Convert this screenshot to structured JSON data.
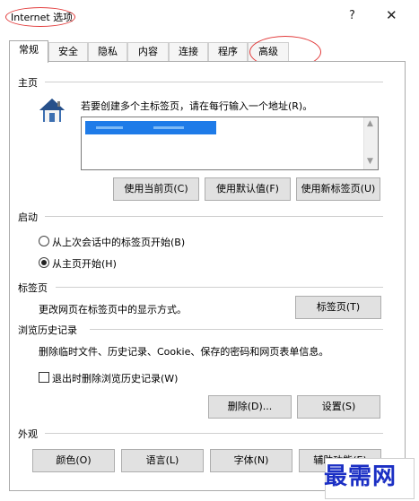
{
  "window": {
    "title": "Internet 选项",
    "help_label": "?",
    "close_label": "✕"
  },
  "tabs": [
    {
      "label": "常规",
      "active": true
    },
    {
      "label": "安全"
    },
    {
      "label": "隐私"
    },
    {
      "label": "内容"
    },
    {
      "label": "连接"
    },
    {
      "label": "程序"
    },
    {
      "label": "高级"
    }
  ],
  "home": {
    "section_label": "主页",
    "instruction": "若要创建多个主标签页，请在每行输入一个地址(R)。",
    "buttons": {
      "current": "使用当前页(C)",
      "default": "使用默认值(F)",
      "new_tab": "使用新标签页(U)"
    }
  },
  "startup": {
    "section_label": "启动",
    "option_last_session": "从上次会话中的标签页开始(B)",
    "option_home_page": "从主页开始(H)",
    "selected": "home_page"
  },
  "tabs_section": {
    "section_label": "标签页",
    "description": "更改网页在标签页中的显示方式。",
    "button": "标签页(T)"
  },
  "history": {
    "section_label": "浏览历史记录",
    "description": "删除临时文件、历史记录、Cookie、保存的密码和网页表单信息。",
    "checkbox_label": "退出时删除浏览历史记录(W)",
    "checkbox_checked": false,
    "delete_button": "删除(D)...",
    "settings_button": "设置(S)"
  },
  "appearance": {
    "section_label": "外观",
    "buttons": {
      "colors": "颜色(O)",
      "languages": "语言(L)",
      "fonts": "字体(N)",
      "accessibility": "辅助功能(E)"
    }
  },
  "watermark": {
    "text": "最需网"
  },
  "colors": {
    "annotation": "#e23b3b",
    "selection": "#1e7be8",
    "watermark": "#1b2fc4"
  }
}
